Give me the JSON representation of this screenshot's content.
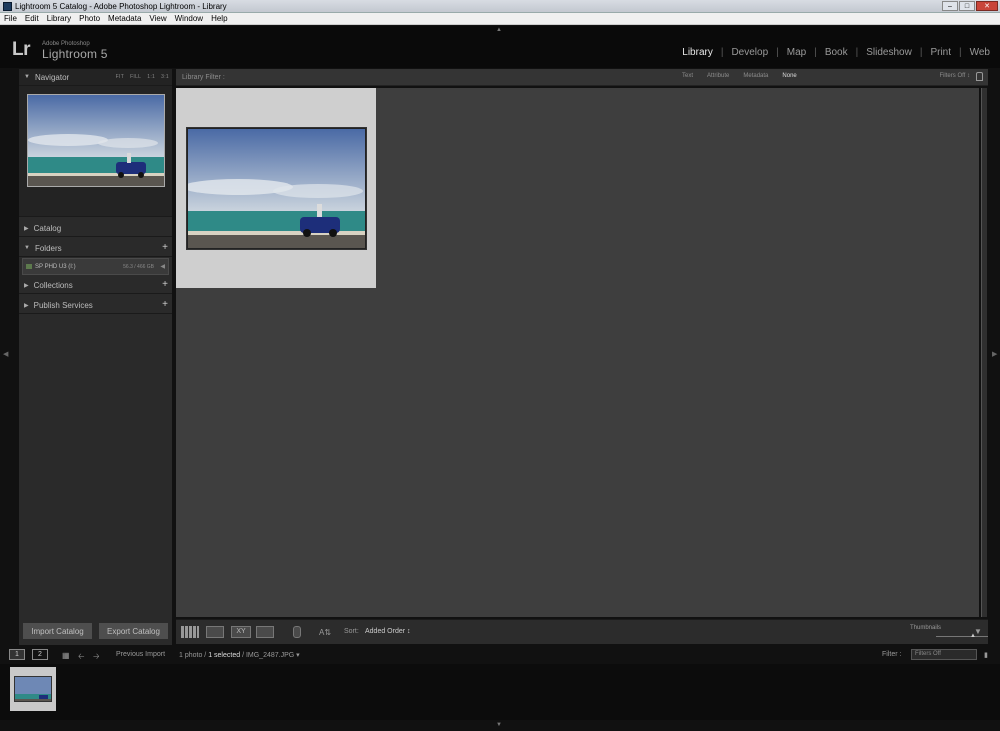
{
  "window": {
    "title": "Lightroom 5 Catalog - Adobe Photoshop Lightroom - Library"
  },
  "menu": [
    "File",
    "Edit",
    "Library",
    "Photo",
    "Metadata",
    "View",
    "Window",
    "Help"
  ],
  "identity": {
    "logo": "Lr",
    "brand_small": "Adobe Photoshop",
    "brand": "Lightroom 5"
  },
  "modules": [
    "Library",
    "Develop",
    "Map",
    "Book",
    "Slideshow",
    "Print",
    "Web"
  ],
  "active_module": "Library",
  "left_panel": {
    "navigator": {
      "label": "Navigator",
      "options": [
        "FIT",
        "FILL",
        "1:1",
        "3:1"
      ]
    },
    "catalog": {
      "label": "Catalog"
    },
    "folders": {
      "label": "Folders",
      "drive": "SP PHD U3 (I:)",
      "capacity": "56.3 / 466 GB"
    },
    "collections": {
      "label": "Collections"
    },
    "publish": {
      "label": "Publish Services"
    },
    "import_label": "Import Catalog",
    "export_label": "Export Catalog"
  },
  "library_filter": {
    "label": "Library Filter :",
    "tabs": [
      "Text",
      "Attribute",
      "Metadata",
      "None"
    ],
    "active_tab": "None",
    "filters_off": "Filters Off ↕"
  },
  "toolbar": {
    "sort_label": "Sort:",
    "sort_value": "Added Order ↕",
    "thumbnails_label": "Thumbnails"
  },
  "filmstrip_bar": {
    "monitor1": "1",
    "monitor2": "2",
    "source": "Previous Import",
    "count": "1 photo / ",
    "selected": "1 selected",
    "filename": " / IMG_2487.JPG ▾",
    "filter_label": "Filter :",
    "filter_value": "Filters Off"
  },
  "colors": {
    "sky_top": "#4a6aa5",
    "sky_bottom": "#c9d3dd",
    "sea": "#2f8a87",
    "road": "#5a5650",
    "car": "#1d2e7a"
  }
}
